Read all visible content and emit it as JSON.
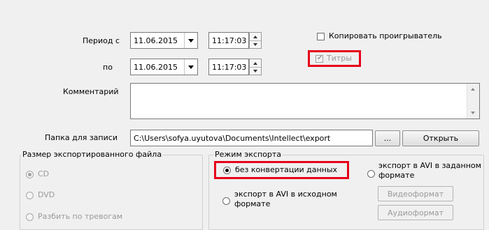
{
  "period": {
    "from_label": "Период с",
    "to_label": "по",
    "from_date": "11.06.2015",
    "from_time": "11:17:03",
    "to_date": "11.06.2015",
    "to_time": "11:17:03"
  },
  "options": {
    "copy_player_label": "Копировать проигрыватель",
    "copy_player_checked": false,
    "subtitles_label": "Титры",
    "subtitles_checked": true,
    "subtitles_enabled": false
  },
  "comment": {
    "label": "Комментарий",
    "value": ""
  },
  "folder": {
    "label": "Папка для записи",
    "path": "C:\\Users\\sofya.uyutova\\Documents\\Intellect\\export",
    "browse_label": "...",
    "open_label": "Открыть"
  },
  "file_size_group": {
    "title": "Размер экспортированного файла",
    "options": [
      {
        "label": "CD",
        "selected": true
      },
      {
        "label": "DVD",
        "selected": false
      },
      {
        "label": "Разбить по тревогам",
        "selected": false
      }
    ]
  },
  "export_mode_group": {
    "title": "Режим экспорта",
    "no_conversion_label": "без конвертации данных",
    "avi_source_label_line1": "экспорт в AVI в исходном",
    "avi_source_label_line2": "формате",
    "avi_custom_label_line1": "экспорт в AVI в заданном",
    "avi_custom_label_line2": "формате",
    "video_format_label": "Видеоформат",
    "audio_format_label": "Аудиоформат",
    "selected": "no_conversion"
  },
  "colors": {
    "highlight": "#e6001a",
    "disabled_text": "#9a9a9a",
    "background": "#f0f0f0"
  }
}
